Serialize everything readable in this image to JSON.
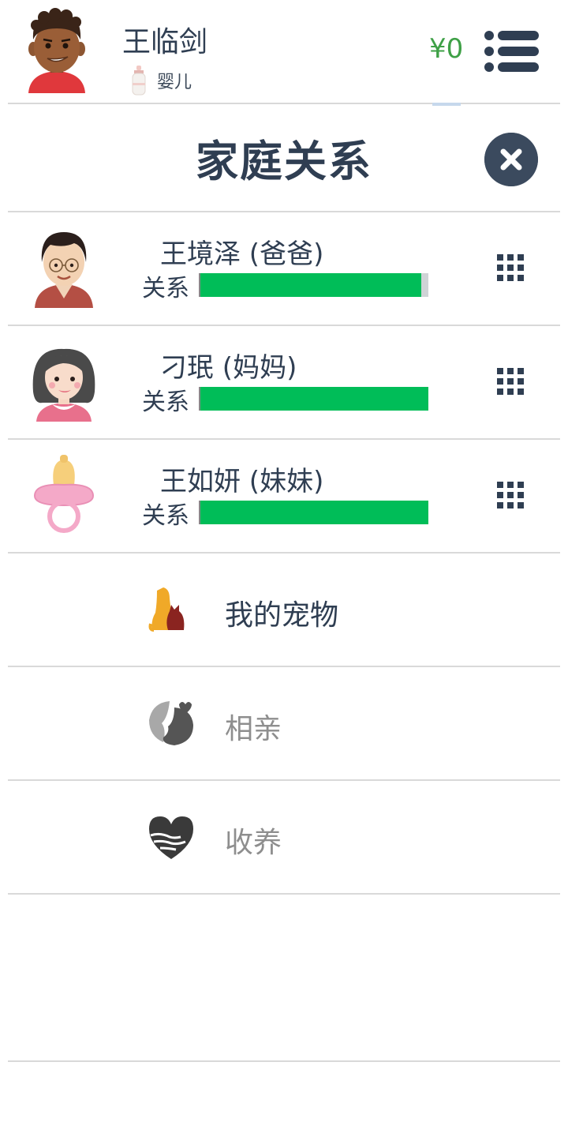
{
  "header": {
    "user_name": "王临剑",
    "stage_icon": "baby-bottle-icon",
    "stage_label": "婴儿",
    "money": "¥0",
    "menu_icon": "list-menu-icon"
  },
  "panel": {
    "title": "家庭关系",
    "close_icon": "close-icon"
  },
  "members": [
    {
      "name": "王境泽 (爸爸)",
      "relation_label": "关系",
      "relation_level": 0.97,
      "avatar": "father-avatar",
      "menu_icon": "grid-icon"
    },
    {
      "name": "刁珉 (妈妈)",
      "relation_label": "关系",
      "relation_level": 1.0,
      "avatar": "mother-avatar",
      "menu_icon": "grid-icon"
    },
    {
      "name": "王如妍 (妹妹)",
      "relation_label": "关系",
      "relation_level": 1.0,
      "avatar": "pacifier-avatar",
      "menu_icon": "grid-icon"
    }
  ],
  "options": [
    {
      "label": "我的宠物",
      "icon": "pet-icon",
      "enabled": true
    },
    {
      "label": "相亲",
      "icon": "kiss-icon",
      "enabled": false
    },
    {
      "label": "收养",
      "icon": "heart-hands-icon",
      "enabled": false
    }
  ],
  "colors": {
    "text_dark": "#2f3e52",
    "text_disabled": "#8e8e8e",
    "money_green": "#3ea046",
    "bar_green": "#00bd58",
    "bar_track": "#cfd3d6",
    "close_bg": "#3b4a5e"
  }
}
